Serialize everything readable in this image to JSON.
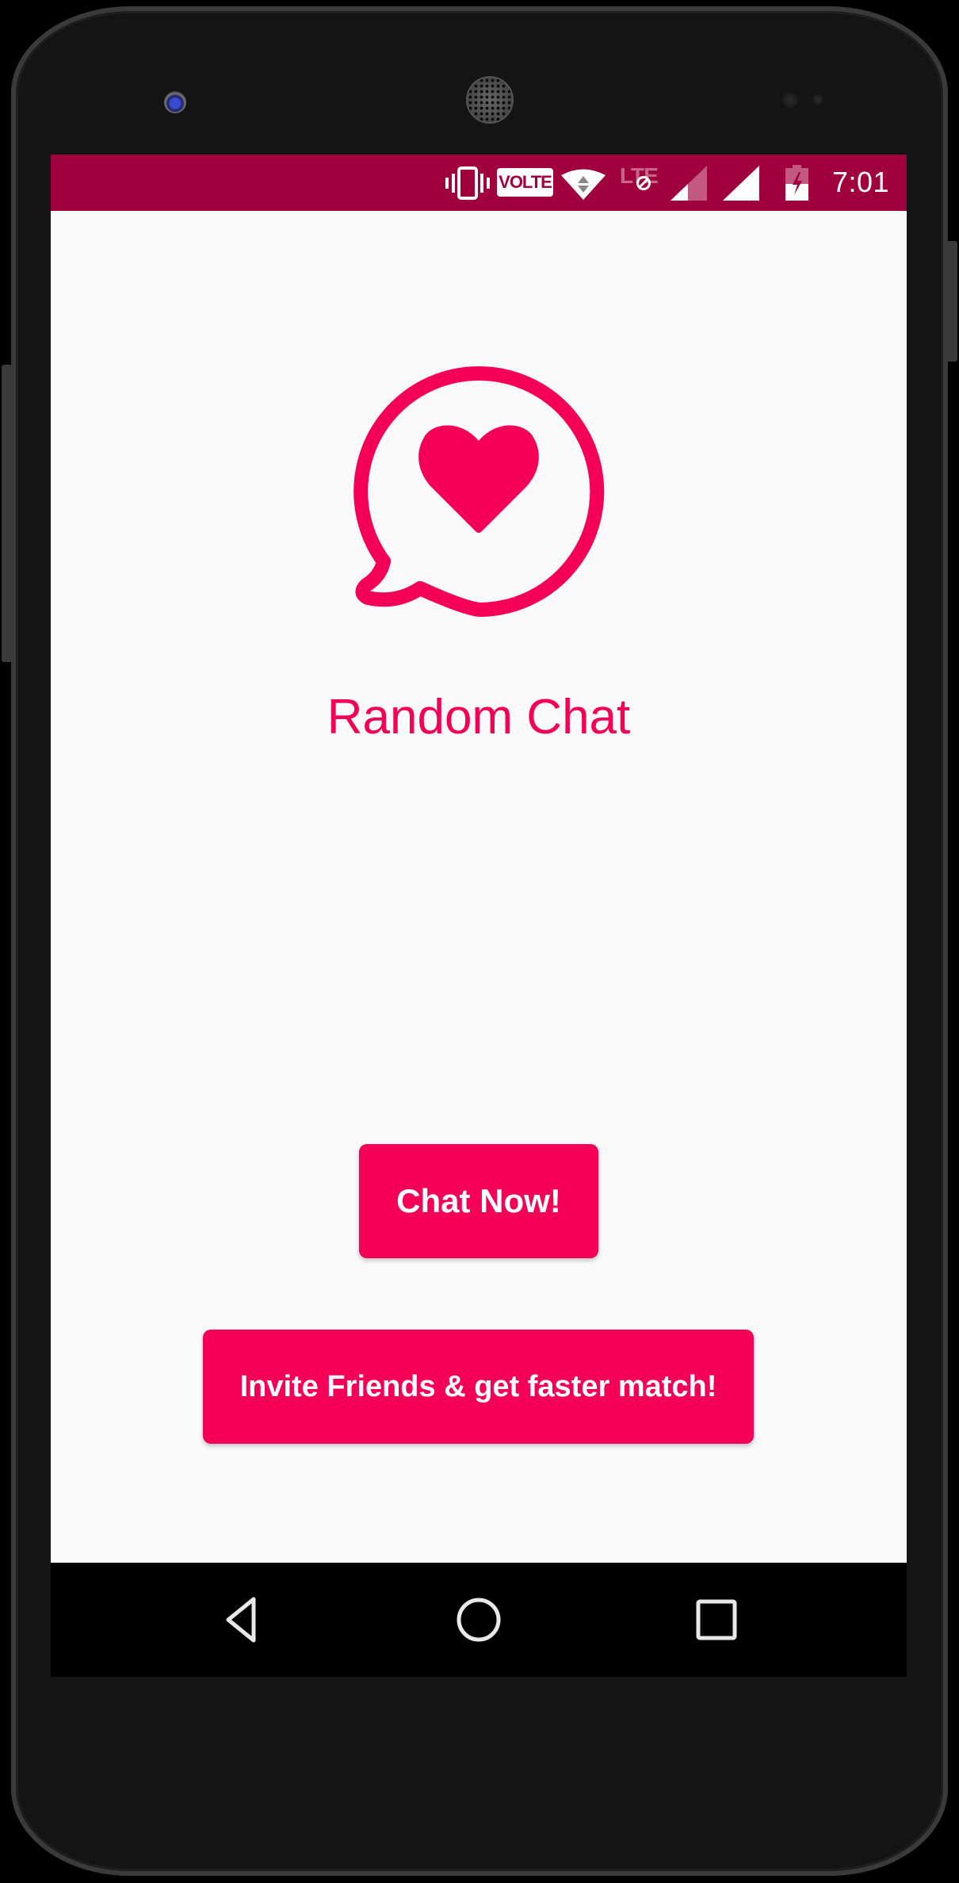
{
  "device": {
    "frame": "phone",
    "bezel_color": "#141414"
  },
  "status_bar": {
    "background": "#a0003c",
    "icons": [
      "vibrate-icon",
      "volte-icon",
      "wifi-icon",
      "lte-icon",
      "signal-icon",
      "signal-icon",
      "battery-charging-icon"
    ],
    "volte_label": "VOLTE",
    "lte_label": "LTE",
    "time": "7:01"
  },
  "app": {
    "background": "#fafafa",
    "accent_color": "#f50057",
    "logo_icon": "heart-chat-bubble-icon",
    "title": "Random Chat",
    "buttons": {
      "chat_now": "Chat Now!",
      "invite": "Invite Friends & get faster match!"
    }
  },
  "nav_bar": {
    "items": [
      "back-icon",
      "home-icon",
      "recents-icon"
    ]
  }
}
